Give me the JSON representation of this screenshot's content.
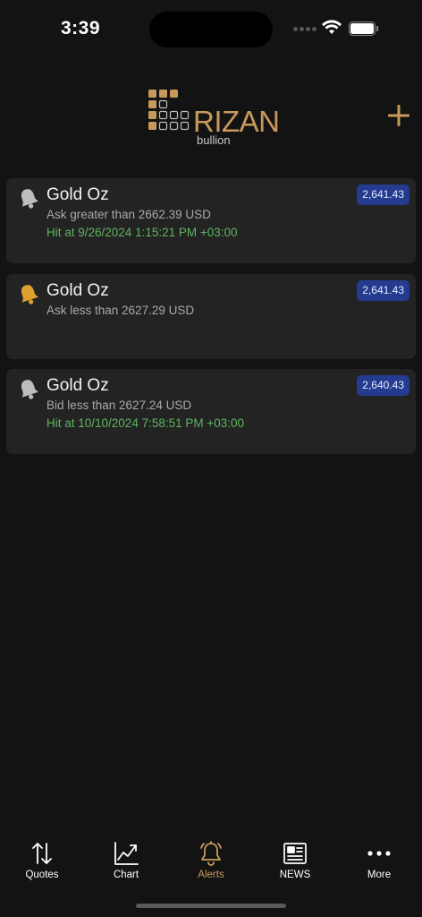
{
  "status_bar": {
    "time": "3:39",
    "icons": [
      "cellular-signal-icon",
      "wifi-icon",
      "battery-icon"
    ]
  },
  "header": {
    "logo_name": "RIZAN",
    "logo_sub": "bullion",
    "add_icon": "plus-icon",
    "accent_color": "#c79a5c"
  },
  "alerts": [
    {
      "symbol": "Gold Oz",
      "condition": "Ask greater than 2662.39 USD",
      "hit": "Hit at 9/26/2024 1:15:21 PM +03:00",
      "price": "2,641.43",
      "bell_state": "inactive",
      "bell_icon": "bell-icon"
    },
    {
      "symbol": "Gold Oz",
      "condition": "Ask less than 2627.29 USD",
      "hit": "",
      "price": "2,641.43",
      "bell_state": "active",
      "bell_icon": "bell-icon"
    },
    {
      "symbol": "Gold Oz",
      "condition": "Bid less than 2627.24 USD",
      "hit": "Hit at 10/10/2024 7:58:51 PM +03:00",
      "price": "2,640.43",
      "bell_state": "inactive",
      "bell_icon": "bell-icon"
    }
  ],
  "tabs": [
    {
      "label": "Quotes",
      "icon": "sort-arrows-icon",
      "active": false
    },
    {
      "label": "Chart",
      "icon": "line-chart-icon",
      "active": false
    },
    {
      "label": "Alerts",
      "icon": "bell-icon",
      "active": true
    },
    {
      "label": "NEWS",
      "icon": "newspaper-icon",
      "active": false
    },
    {
      "label": "More",
      "icon": "ellipsis-icon",
      "active": false
    }
  ],
  "colors": {
    "background": "#131313",
    "card": "#232323",
    "badge": "#243b8f",
    "hit_text": "#5fb35f",
    "bell_active": "#e0a030",
    "bell_inactive": "#bdbdbd"
  }
}
